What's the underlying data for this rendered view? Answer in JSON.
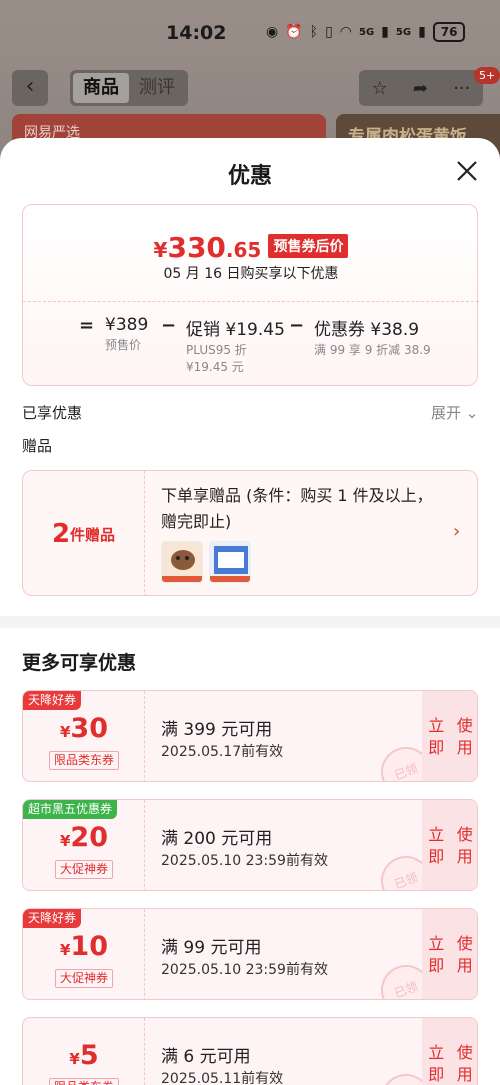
{
  "status_bar": {
    "time": "14:02",
    "network_1": "5G",
    "network_2": "5G",
    "battery": "76"
  },
  "background": {
    "tabs": [
      "商品",
      "测评"
    ],
    "cart_badge": "5+",
    "banner_left": "网易严选",
    "banner_right": "专属肉松蛋黄饭"
  },
  "sheet": {
    "title": "优惠"
  },
  "price_card": {
    "yen": "¥",
    "price_int": "330",
    "price_dec": ".65",
    "tag": "预售券后价",
    "subtitle": "05 月 16 日购买享以下优惠",
    "calc": {
      "eq": "=",
      "presale_value": "¥389",
      "presale_label": "预售价",
      "minus_1": "−",
      "promo_value": "促销 ¥19.45",
      "promo_note_1": "PLUS95 折",
      "promo_note_2": "¥19.45 元",
      "minus_2": "−",
      "coupon_value": "优惠券 ¥38.9",
      "coupon_note": "满 99 享 9 折减 38.9"
    }
  },
  "enjoyed_label": "已享优惠",
  "expand_label": "展开",
  "gift": {
    "section_label": "赠品",
    "count": "2",
    "count_unit": "件赠品",
    "desc": "下单享赠品 (条件：购买 1 件及以上，赠完即止)"
  },
  "more_title": "更多可享优惠",
  "coupons": [
    {
      "tag": "天降好券",
      "tag_color": "#e83a3a",
      "amount": "30",
      "type": "限品类东券",
      "condition": "满 399 元可用",
      "valid": "2025.05.17前有效",
      "action": "立即使用",
      "stamp": "已领"
    },
    {
      "tag": "超市黑五优惠券",
      "tag_color": "#3cb44b",
      "amount": "20",
      "type": "大促神券",
      "condition": "满 200 元可用",
      "valid": "2025.05.10 23:59前有效",
      "action": "立即使用",
      "stamp": "已领"
    },
    {
      "tag": "天降好券",
      "tag_color": "#e83a3a",
      "amount": "10",
      "type": "大促神券",
      "condition": "满 99 元可用",
      "valid": "2025.05.10 23:59前有效",
      "action": "立即使用",
      "stamp": "已领"
    },
    {
      "tag": "",
      "tag_color": "#e83a3a",
      "amount": "5",
      "type": "限品类东券",
      "condition": "满 6 元可用",
      "valid": "2025.05.11前有效",
      "action": "立即使用",
      "stamp": "已领"
    }
  ],
  "colors": {
    "accent": "#e02d2d",
    "sheet_bg": "#ffffff"
  }
}
